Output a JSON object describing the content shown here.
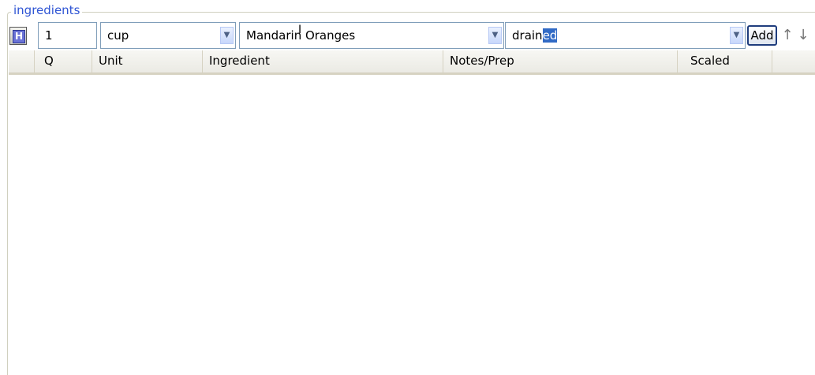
{
  "group": {
    "legend": "ingredients"
  },
  "entry": {
    "h_button_label": "H",
    "quantity": "1",
    "unit": "cup",
    "ingredient": "Mandarin Oranges",
    "notes_typed": "drain",
    "notes_autocomplete": "ed",
    "add_label": "Add",
    "up_arrow": "↑",
    "down_arrow": "↓"
  },
  "table": {
    "columns": [
      "Q",
      "Unit",
      "Ingredient",
      "Notes/Prep",
      "Scaled"
    ],
    "rows": []
  }
}
